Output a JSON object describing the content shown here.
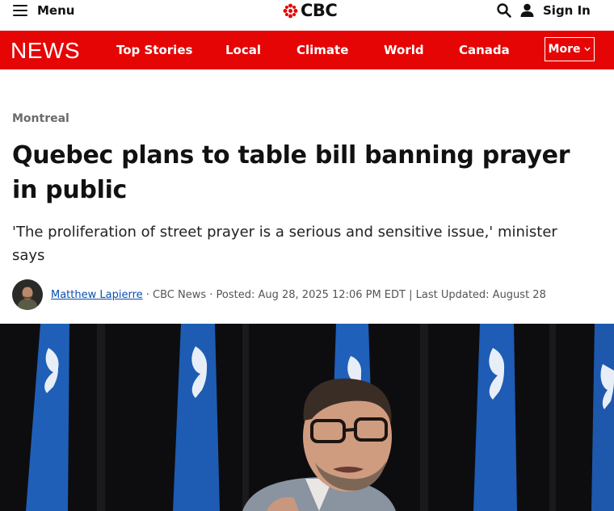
{
  "header": {
    "menu_label": "Menu",
    "logo_text": "CBC",
    "signin_label": "Sign In"
  },
  "nav": {
    "brand": "NEWS",
    "items": [
      "Top Stories",
      "Local",
      "Climate",
      "World",
      "Canada"
    ],
    "more_label": "More",
    "bg_color": "#e60505"
  },
  "article": {
    "section": "Montreal",
    "headline": "Quebec plans to table bill banning prayer in public",
    "deck": "'The proliferation of street prayer is a serious and sensitive issue,' minister says",
    "author": "Matthew Lapierre",
    "meta": " · CBC News · Posted: Aug 28, 2025 12:06 PM EDT | Last Updated: August 28"
  },
  "icons": {
    "menu": "hamburger-icon",
    "logo": "cbc-gem-logo",
    "search": "search-icon",
    "user": "user-icon",
    "more": "chevron-down-icon"
  }
}
